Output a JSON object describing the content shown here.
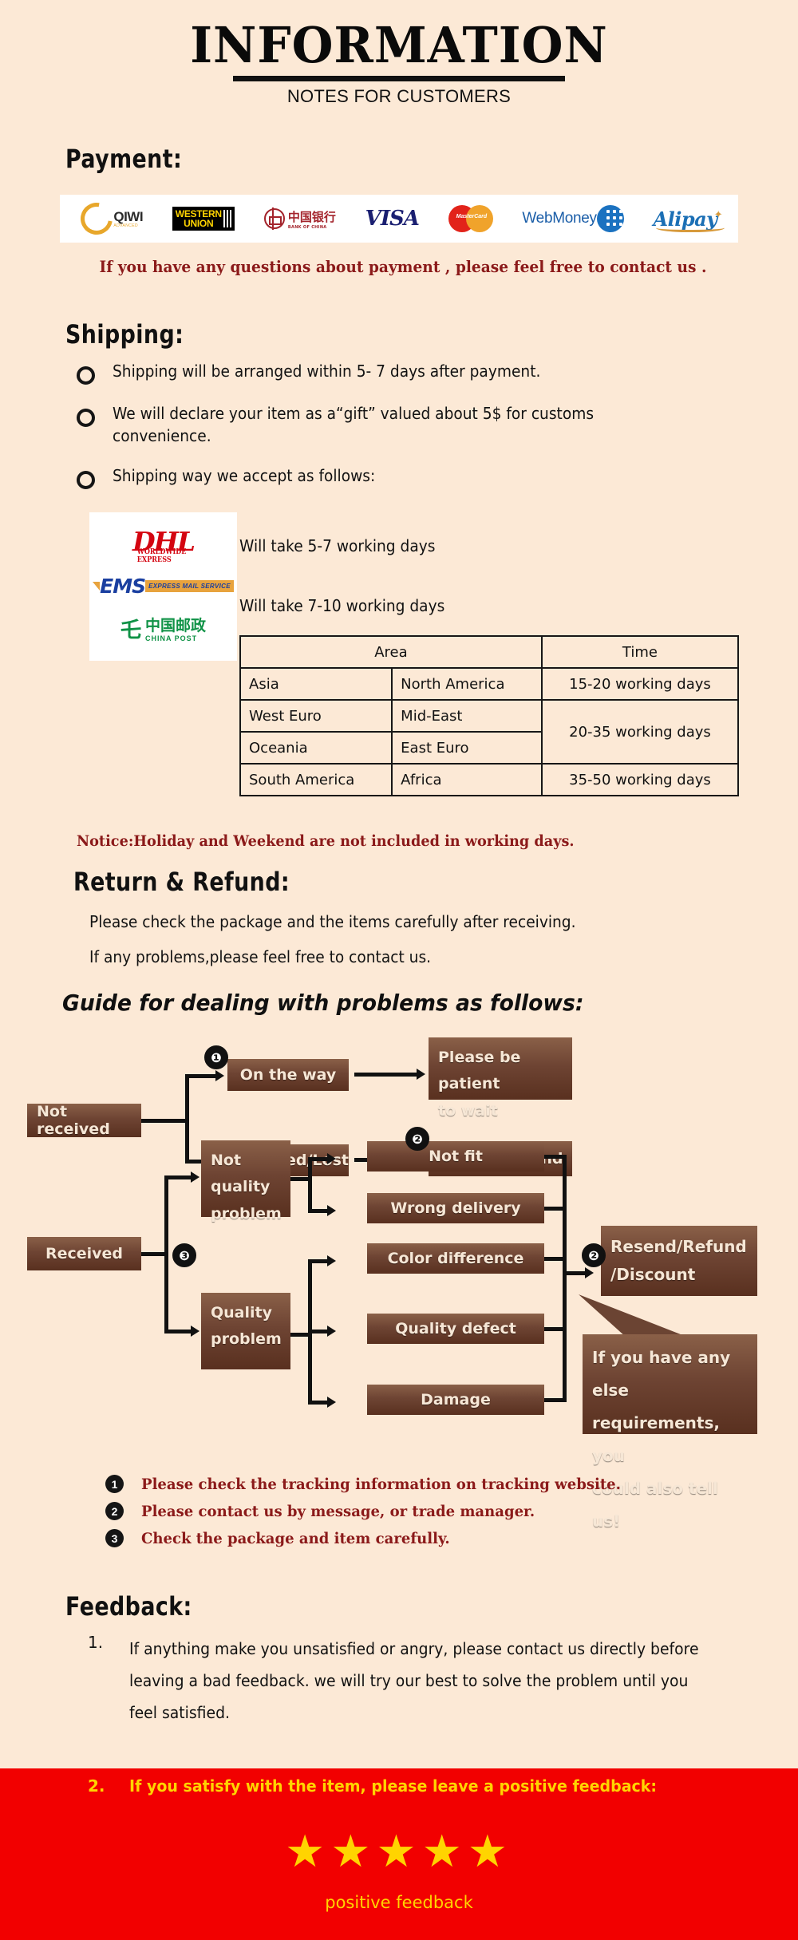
{
  "header": {
    "title": "INFORMATION",
    "subtitle": "NOTES FOR CUSTOMERS"
  },
  "payment": {
    "heading": "Payment:",
    "methods": [
      "QIWI",
      "WESTERN UNION",
      "Bank of China",
      "VISA",
      "MasterCard",
      "WebMoney",
      "Alipay"
    ],
    "qiwi_label": "QIWI",
    "qiwi_sub": "ADVANCED",
    "wu_line1": "WESTERN",
    "wu_line2": "UNION",
    "boc_cn": "中国银行",
    "boc_cn_sub": "BANK OF CHINA",
    "visa_label": "VISA",
    "mastercard_label": "MasterCard",
    "webmoney_label": "WebMoney",
    "alipay_label": "Alipay",
    "note": "If you have any questions about payment , please feel free to contact us ."
  },
  "shipping": {
    "heading": "Shipping:",
    "bullets": [
      "Shipping will be arranged within  5- 7  days after payment.",
      "We will declare your item as a“gift” valued about 5$ for customs convenience.",
      "Shipping way we accept as follows:"
    ],
    "carriers": [
      {
        "name": "DHL",
        "sub": "WORLDWIDE EXPRESS",
        "time": "Will take 5-7 working days"
      },
      {
        "name": "EMS",
        "sub": "EXPRESS MAIL SERVICE",
        "time": "Will take 7-10 working days"
      },
      {
        "name": "中国邮政",
        "sub": "CHINA POST",
        "time": ""
      }
    ],
    "table": {
      "headers": [
        "Area",
        "Time"
      ],
      "rows": [
        {
          "area1": "Asia",
          "area2": "North America",
          "time": "15-20 working days"
        },
        {
          "area1": "West Euro",
          "area2": "Mid-East",
          "time": "20-35 working days"
        },
        {
          "area1": "Oceania",
          "area2": "East Euro",
          "time": ""
        },
        {
          "area1": "South America",
          "area2": "Africa",
          "time": "35-50 working days"
        }
      ]
    },
    "notice": "Notice:Holiday and Weekend are not included in working days."
  },
  "return_refund": {
    "heading": "Return & Refund:",
    "line1": "Please check the package and the items carefully after receiving.",
    "line2": "If any problems,please feel free to contact us.",
    "guide_title": "Guide for dealing with problems as follows:"
  },
  "flow": {
    "not_received": "Not received",
    "on_the_way": "On the way",
    "returned_lost": "Returned/Lost",
    "please_wait": "Please be patient to wait",
    "please_wait_l1": "Please be patient",
    "please_wait_l2": "to wait",
    "resend_refund": "Resend/refund",
    "received": "Received",
    "not_quality_l1": "Not quality",
    "not_quality_l2": "problem",
    "quality_l1": "Quality",
    "quality_l2": "problem",
    "not_fit": "Not fit",
    "wrong_delivery": "Wrong delivery",
    "color_difference": "Color difference",
    "quality_defect": "Quality defect",
    "damage": "Damage",
    "resend_refund_discount_l1": "Resend/Refund",
    "resend_refund_discount_l2": "/Discount",
    "callout_l1": "If you have any else",
    "callout_l2": "requirements, you",
    "callout_l3": "could also tell us!",
    "badge1": "❶",
    "badge2": "❷",
    "badge3": "❸"
  },
  "legend": [
    {
      "num": "❶",
      "text": "Please check the tracking information on tracking website."
    },
    {
      "num": "❷",
      "text": "Please contact us by message, or trade manager."
    },
    {
      "num": "❸",
      "text": "Check the package and item carefully."
    }
  ],
  "feedback": {
    "heading": "Feedback:",
    "item1_no": "1.",
    "item1_text": "If anything make you unsatisfied or angry, please contact us directly before leaving a bad feedback. we will try our best to solve the problem until  you feel satisfied.",
    "item2_no": "2.",
    "item2_text": "If you satisfy with the item, please leave a positive feedback:",
    "stars": "★★★★★",
    "caption": "positive feedback"
  },
  "colors": {
    "background": "#fce9d6",
    "accent_red": "#8b1a1a",
    "band_red": "#f20000",
    "star_yellow": "#ffd400",
    "box_brown": "#6e4433"
  }
}
